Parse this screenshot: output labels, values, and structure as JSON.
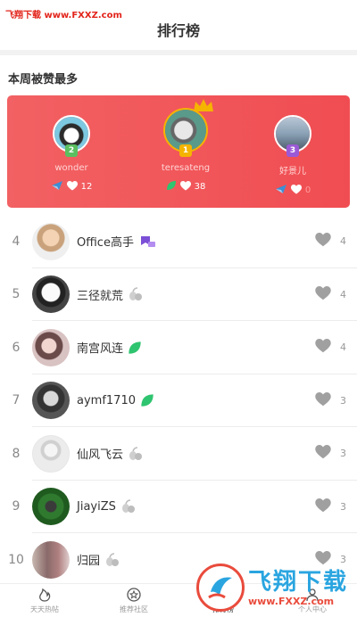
{
  "watermark": {
    "top_text": "飞翔下载 www.FXXZ.com",
    "logo_big": "飞翔下载",
    "logo_url": "www.FXXZ.com"
  },
  "header": {
    "title": "排行榜"
  },
  "section": {
    "title": "本周被赞最多"
  },
  "podium": [
    {
      "rank": "2",
      "name": "wonder",
      "likes": "12",
      "badge_icon": "airplane-icon",
      "badge_color": "#3b8fd6"
    },
    {
      "rank": "1",
      "name": "teresateng",
      "likes": "38",
      "badge_icon": "leaf-icon",
      "badge_color": "#2fc46f"
    },
    {
      "rank": "3",
      "name": "好景儿",
      "likes": "0",
      "badge_icon": "airplane-icon",
      "badge_color": "#3b8fd6"
    }
  ],
  "colors": {
    "podium_bg": "#f04d52",
    "gold": "#f5b400",
    "silver": "#5bbf60",
    "bronze": "#9b59d6"
  },
  "ranking": [
    {
      "rank": "4",
      "name": "Office高手",
      "likes": "4",
      "badge": "ribbon-icon"
    },
    {
      "rank": "5",
      "name": "三径就荒",
      "likes": "4",
      "badge": "seed-icon"
    },
    {
      "rank": "6",
      "name": "南宫风连",
      "likes": "4",
      "badge": "leaf-icon"
    },
    {
      "rank": "7",
      "name": "aymf1710",
      "likes": "3",
      "badge": "leaf-icon"
    },
    {
      "rank": "8",
      "name": "仙风飞云",
      "likes": "3",
      "badge": "seed-icon"
    },
    {
      "rank": "9",
      "name": "JiayiZS",
      "likes": "3",
      "badge": "seed-icon"
    },
    {
      "rank": "10",
      "name": "归园",
      "likes": "3",
      "badge": "seed-icon"
    }
  ],
  "tabs": [
    {
      "label": "天天热帖",
      "icon": "flame-icon"
    },
    {
      "label": "推荐社区",
      "icon": "star-circle-icon"
    },
    {
      "label": "排行榜",
      "icon": "trophy-icon"
    },
    {
      "label": "个人中心",
      "icon": "person-icon"
    }
  ]
}
